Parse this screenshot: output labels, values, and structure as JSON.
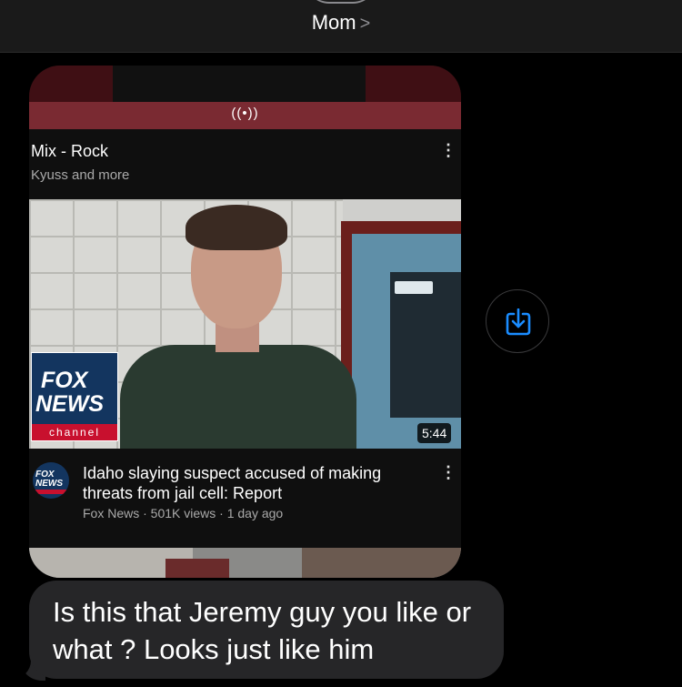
{
  "header": {
    "contact_name": "Mom",
    "chevron": ">"
  },
  "mix": {
    "live_icon": "((•))",
    "title": "Mix - Rock",
    "subtitle": "Kyuss and more",
    "more_icon": "⋮"
  },
  "video": {
    "logo_fox": "FOX",
    "logo_news": "NEWS",
    "logo_channel": "channel",
    "duration": "5:44",
    "channel_avatar_text": "FOX NEWS",
    "title": "Idaho slaying suspect accused of making threats from jail cell: Report",
    "meta": "Fox News · 501K views · 1 day ago",
    "more_icon": "⋮"
  },
  "save_button": {
    "icon": "save-to-device-icon",
    "color": "#1a8cff"
  },
  "message": {
    "text": "Is this that Jeremy guy you like or what ? Looks just like him"
  }
}
